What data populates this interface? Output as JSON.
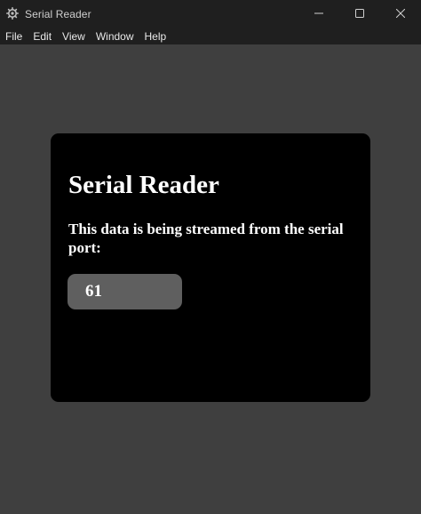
{
  "window": {
    "title": "Serial Reader",
    "icons": {
      "app": "gear-icon",
      "minimize": "minimize-icon",
      "maximize": "maximize-icon",
      "close": "close-icon"
    }
  },
  "menu": {
    "items": [
      {
        "label": "File"
      },
      {
        "label": "Edit"
      },
      {
        "label": "View"
      },
      {
        "label": "Window"
      },
      {
        "label": "Help"
      }
    ]
  },
  "main": {
    "heading": "Serial Reader",
    "description": "This data is being streamed from the serial port:",
    "value": "61"
  },
  "colors": {
    "window_background": "#3f3f3f",
    "titlebar_background": "#1f1f1f",
    "card_background": "#000000",
    "value_box_background": "#5f5f5f",
    "text": "#ffffff"
  }
}
